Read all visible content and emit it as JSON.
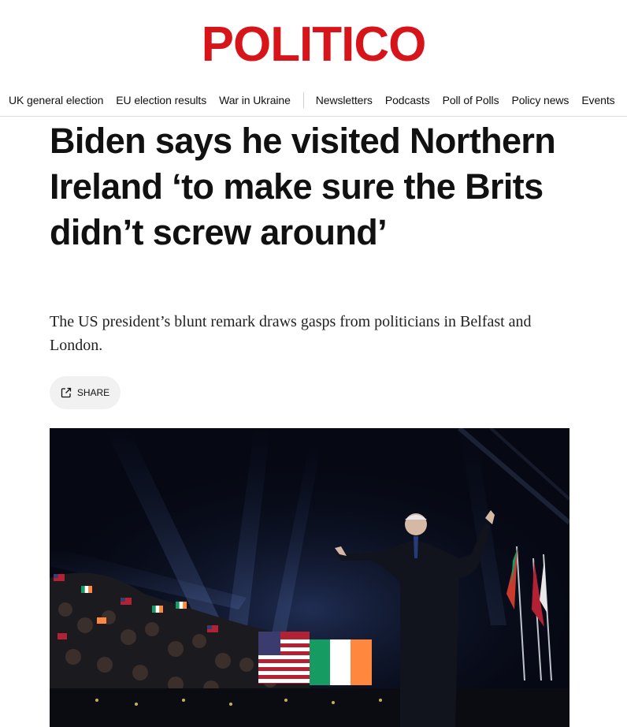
{
  "site": {
    "logo": "POLITICO",
    "brand_color": "#d7141a"
  },
  "nav": {
    "primary": [
      {
        "label": "UK general election"
      },
      {
        "label": "EU election results"
      },
      {
        "label": "War in Ukraine"
      }
    ],
    "secondary": [
      {
        "label": "Newsletters"
      },
      {
        "label": "Podcasts"
      },
      {
        "label": "Poll of Polls"
      },
      {
        "label": "Policy news"
      },
      {
        "label": "Events"
      }
    ]
  },
  "article": {
    "headline": "Biden says he visited Northern Ireland ‘to make sure the Brits didn’t screw around’",
    "dek": "The US president’s blunt remark draws gasps from politicians in Belfast and London.",
    "share_label": "SHARE",
    "share_icon": "external-share-icon"
  }
}
